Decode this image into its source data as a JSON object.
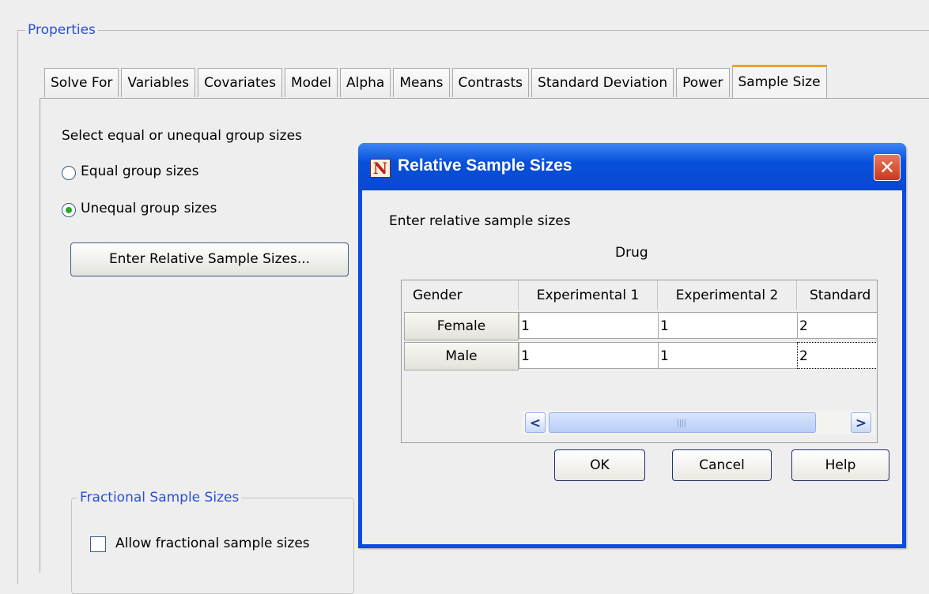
{
  "properties": {
    "title": "Properties",
    "tabs": [
      "Solve For",
      "Variables",
      "Covariates",
      "Model",
      "Alpha",
      "Means",
      "Contrasts",
      "Standard Deviation",
      "Power",
      "Sample Size"
    ],
    "active_tab": "Sample Size"
  },
  "sample_size_panel": {
    "prompt": "Select equal or unequal group sizes",
    "equal_label": "Equal group sizes",
    "unequal_label": "Unequal group sizes",
    "selected": "Unequal group sizes",
    "enter_button": "Enter Relative Sample Sizes...",
    "fractional_group_title": "Fractional Sample Sizes",
    "allow_fractional_label": "Allow fractional sample sizes",
    "allow_fractional_checked": false
  },
  "dialog": {
    "title": "Relative Sample Sizes",
    "icon_letter": "N",
    "prompt": "Enter relative sample sizes",
    "factor_label": "Drug",
    "row_header_label": "Gender",
    "columns": [
      "Experimental 1",
      "Experimental 2",
      "Standard"
    ],
    "rows": [
      {
        "label": "Female",
        "values": [
          "1",
          "1",
          "2"
        ]
      },
      {
        "label": "Male",
        "values": [
          "1",
          "1",
          "2"
        ]
      }
    ],
    "ok_label": "OK",
    "cancel_label": "Cancel",
    "help_label": "Help"
  },
  "colors": {
    "group_title": "#2a4fd8",
    "active_tab_accent": "#f2a028",
    "dialog_titlebar": "#0a47cf",
    "close_button": "#c9381a"
  }
}
